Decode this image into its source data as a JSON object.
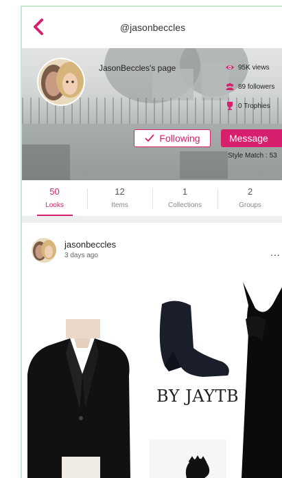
{
  "header": {
    "handle": "@jasonbeccles"
  },
  "profile": {
    "page_name": "JasonBeccles's page",
    "stats": {
      "views": "95K views",
      "followers": "89 followers",
      "trophies": "0 Trophies"
    },
    "following_label": "Following",
    "message_label": "Message",
    "style_match": "Style Match : 53"
  },
  "tabs": [
    {
      "count": "50",
      "label": "Looks"
    },
    {
      "count": "12",
      "label": "Items"
    },
    {
      "count": "1",
      "label": "Collections"
    },
    {
      "count": "2",
      "label": "Groups"
    }
  ],
  "post": {
    "username": "jasonbeccles",
    "time": "3 days ago",
    "more": "...",
    "brand_text": "BY JAYTB"
  },
  "colors": {
    "accent": "#d6206d",
    "frame_border": "#c9e6cf"
  },
  "icons": [
    "back-chevron-icon",
    "eye-icon",
    "followers-icon",
    "trophy-icon",
    "checkmark-icon",
    "more-dots-icon"
  ]
}
